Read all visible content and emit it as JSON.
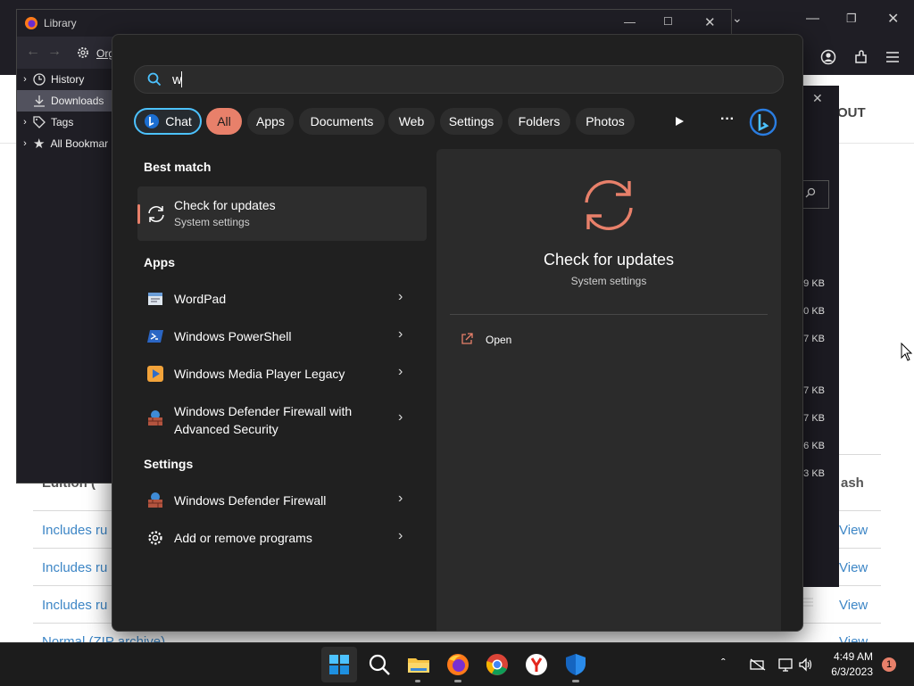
{
  "library": {
    "title": "Library",
    "toolbar_label": "Org",
    "sidebar": [
      {
        "label": "History",
        "icon": "history-clock-icon"
      },
      {
        "label": "Downloads",
        "icon": "download-arrow-icon"
      },
      {
        "label": "Tags",
        "icon": "tag-icon"
      },
      {
        "label": "All Bookmar",
        "icon": "star-icon"
      }
    ]
  },
  "background_page": {
    "header_right": "OUT",
    "column_header_left": "Edition (",
    "column_header_right": "ash",
    "rows": [
      {
        "edition": "Includes ru",
        "link": "View"
      },
      {
        "edition": "Includes ru",
        "link": "View"
      },
      {
        "edition": "Includes ru",
        "link": "View"
      },
      {
        "edition": "Normal (ZIP archive)",
        "link": "View"
      }
    ]
  },
  "downloads_sizes": [
    "9 KB",
    "0 KB",
    "7 KB",
    "7 KB",
    "7 KB",
    "6 KB",
    "3 KB"
  ],
  "search": {
    "query": "w",
    "filters": [
      {
        "label": "Chat",
        "icon": "bing-chat-icon"
      },
      {
        "label": "All",
        "active": true
      },
      {
        "label": "Apps"
      },
      {
        "label": "Documents"
      },
      {
        "label": "Web"
      },
      {
        "label": "Settings"
      },
      {
        "label": "Folders"
      },
      {
        "label": "Photos"
      }
    ],
    "best_match_title": "Best match",
    "best_match": {
      "title": "Check for updates",
      "subtitle": "System settings",
      "icon": "refresh-arrows-icon"
    },
    "apps_title": "Apps",
    "apps": [
      {
        "label": "WordPad",
        "icon": "wordpad-icon"
      },
      {
        "label": "Windows PowerShell",
        "icon": "powershell-icon"
      },
      {
        "label": "Windows Media Player Legacy",
        "icon": "media-player-icon"
      },
      {
        "label_line1": "Windows Defender Firewall with",
        "label_line2": "Advanced Security",
        "icon": "firewall-advanced-icon"
      }
    ],
    "settings_title": "Settings",
    "settings": [
      {
        "label": "Windows Defender Firewall",
        "icon": "firewall-icon"
      },
      {
        "label": "Add or remove programs",
        "icon": "gear-icon"
      }
    ],
    "preview": {
      "title": "Check for updates",
      "subtitle": "System settings",
      "action": "Open",
      "accent": "#e8806a"
    }
  },
  "taskbar": {
    "icons": [
      "windows-start-icon",
      "search-icon",
      "file-explorer-icon",
      "firefox-icon",
      "chrome-icon",
      "yandex-icon",
      "defender-shield-icon"
    ],
    "time": "4:49 AM",
    "date": "6/3/2023",
    "notification_count": "1"
  }
}
